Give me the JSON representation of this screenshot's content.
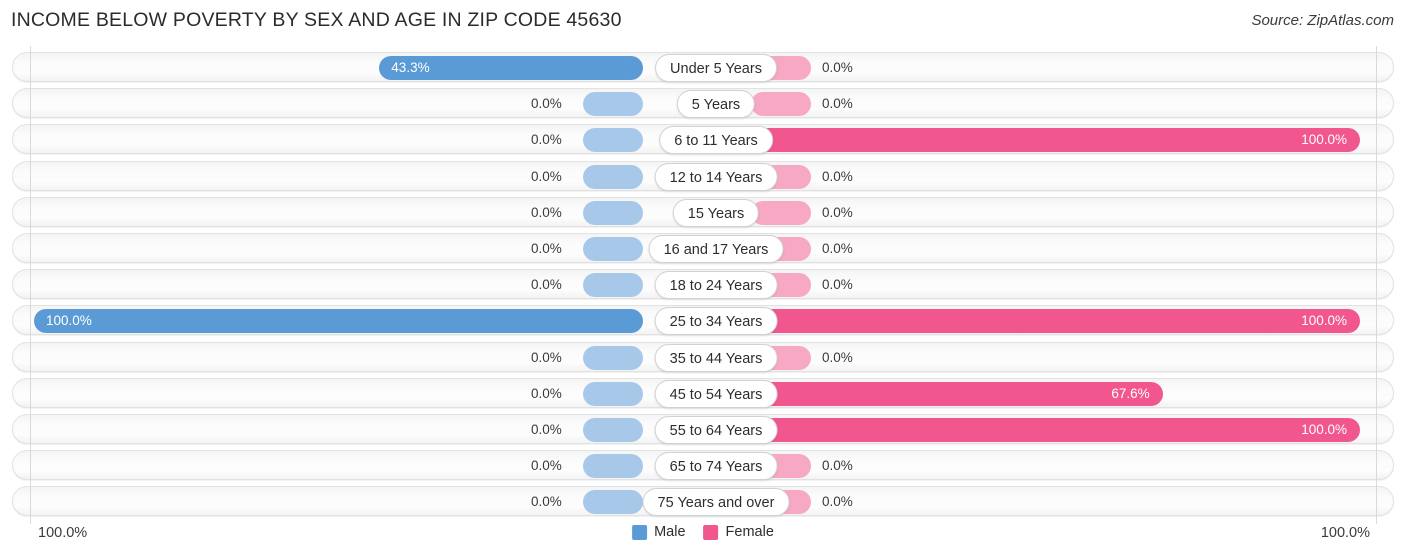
{
  "header": {
    "title": "INCOME BELOW POVERTY BY SEX AND AGE IN ZIP CODE 45630",
    "source": "Source: ZipAtlas.com"
  },
  "legend": {
    "male_label": "Male",
    "female_label": "Female",
    "male_color": "#5b9bd5",
    "female_color": "#f2568f"
  },
  "axis": {
    "left_end": "100.0%",
    "right_end": "100.0%"
  },
  "chart_data": {
    "type": "bar",
    "title": "INCOME BELOW POVERTY BY SEX AND AGE IN ZIP CODE 45630",
    "subtitle": "Source: ZipAtlas.com",
    "orientation": "horizontal-diverging",
    "xlabel": "",
    "ylabel": "",
    "xlim": [
      0,
      100
    ],
    "grid": false,
    "legend_position": "bottom-center",
    "categories": [
      "Under 5 Years",
      "5 Years",
      "6 to 11 Years",
      "12 to 14 Years",
      "15 Years",
      "16 and 17 Years",
      "18 to 24 Years",
      "25 to 34 Years",
      "35 to 44 Years",
      "45 to 54 Years",
      "55 to 64 Years",
      "65 to 74 Years",
      "75 Years and over"
    ],
    "series": [
      {
        "name": "Male",
        "color": "#5b9bd5",
        "values": [
          43.3,
          0.0,
          0.0,
          0.0,
          0.0,
          0.0,
          0.0,
          100.0,
          0.0,
          0.0,
          0.0,
          0.0,
          0.0
        ],
        "labels": [
          "43.3%",
          "0.0%",
          "0.0%",
          "0.0%",
          "0.0%",
          "0.0%",
          "0.0%",
          "100.0%",
          "0.0%",
          "0.0%",
          "0.0%",
          "0.0%",
          "0.0%"
        ]
      },
      {
        "name": "Female",
        "color": "#f2568f",
        "values": [
          0.0,
          0.0,
          100.0,
          0.0,
          0.0,
          0.0,
          0.0,
          100.0,
          0.0,
          67.6,
          100.0,
          0.0,
          0.0
        ],
        "labels": [
          "0.0%",
          "0.0%",
          "100.0%",
          "0.0%",
          "0.0%",
          "0.0%",
          "0.0%",
          "100.0%",
          "0.0%",
          "67.6%",
          "100.0%",
          "0.0%",
          "0.0%"
        ]
      }
    ]
  }
}
